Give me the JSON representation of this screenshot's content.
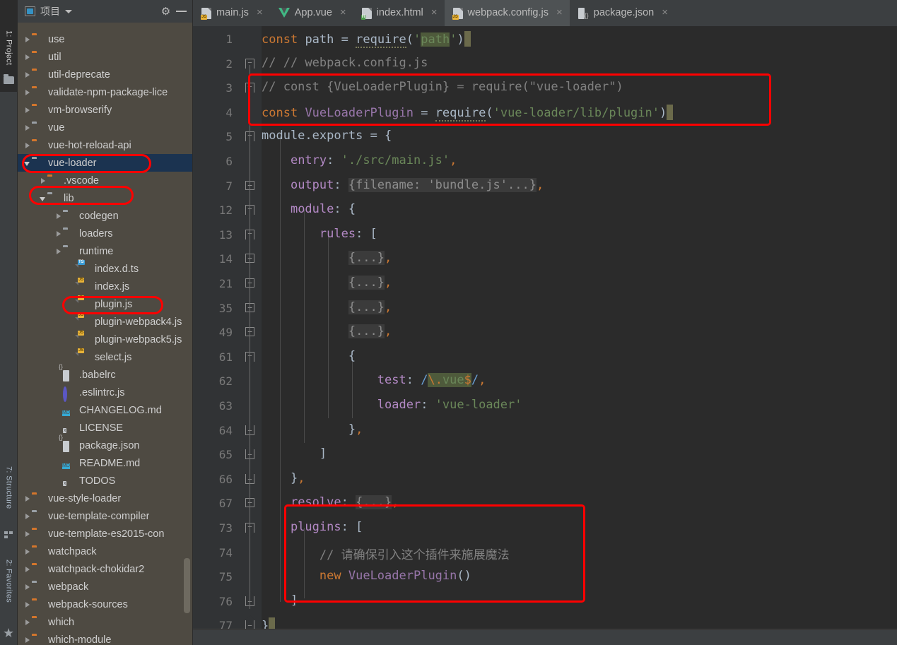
{
  "toolstrip": {
    "project": "1: Project",
    "structure": "7: Structure",
    "favorites": "2: Favorites",
    "project_icon": "folder-icon",
    "structure_icon": "grid-icon",
    "favorites_icon": "star-icon"
  },
  "panel": {
    "title": "项目",
    "dropdown_icon": "chevron-down-icon",
    "settings_icon": "gear-icon",
    "hide_icon": "minus-icon",
    "window_icon": "project-window-icon"
  },
  "tree": [
    {
      "label": "use",
      "indent": 0,
      "arrow": "closed",
      "icon": "folder-orange",
      "selected": false
    },
    {
      "label": "util",
      "indent": 0,
      "arrow": "closed",
      "icon": "folder-orange",
      "selected": false
    },
    {
      "label": "util-deprecate",
      "indent": 0,
      "arrow": "closed",
      "icon": "folder-orange",
      "selected": false
    },
    {
      "label": "validate-npm-package-lice",
      "indent": 0,
      "arrow": "closed",
      "icon": "folder-orange",
      "selected": false
    },
    {
      "label": "vm-browserify",
      "indent": 0,
      "arrow": "closed",
      "icon": "folder-orange",
      "selected": false
    },
    {
      "label": "vue",
      "indent": 0,
      "arrow": "closed",
      "icon": "folder-grey",
      "selected": false
    },
    {
      "label": "vue-hot-reload-api",
      "indent": 0,
      "arrow": "closed",
      "icon": "folder-orange",
      "selected": false
    },
    {
      "label": "vue-loader",
      "indent": 0,
      "arrow": "open",
      "icon": "folder-grey",
      "selected": true
    },
    {
      "label": ".vscode",
      "indent": 1,
      "arrow": "closed",
      "icon": "folder-orange",
      "selected": false
    },
    {
      "label": "lib",
      "indent": 1,
      "arrow": "open",
      "icon": "folder-grey",
      "selected": false
    },
    {
      "label": "codegen",
      "indent": 2,
      "arrow": "closed",
      "icon": "folder-grey",
      "selected": false
    },
    {
      "label": "loaders",
      "indent": 2,
      "arrow": "closed",
      "icon": "folder-grey",
      "selected": false
    },
    {
      "label": "runtime",
      "indent": 2,
      "arrow": "closed",
      "icon": "folder-grey",
      "selected": false
    },
    {
      "label": "index.d.ts",
      "indent": 3,
      "arrow": "none",
      "icon": "file-ts",
      "selected": false
    },
    {
      "label": "index.js",
      "indent": 3,
      "arrow": "none",
      "icon": "file-js",
      "selected": false
    },
    {
      "label": "plugin.js",
      "indent": 3,
      "arrow": "none",
      "icon": "file-js",
      "selected": false
    },
    {
      "label": "plugin-webpack4.js",
      "indent": 3,
      "arrow": "none",
      "icon": "file-js",
      "selected": false
    },
    {
      "label": "plugin-webpack5.js",
      "indent": 3,
      "arrow": "none",
      "icon": "file-js",
      "selected": false
    },
    {
      "label": "select.js",
      "indent": 3,
      "arrow": "none",
      "icon": "file-js",
      "selected": false
    },
    {
      "label": ".babelrc",
      "indent": 2,
      "arrow": "none",
      "icon": "file-json",
      "selected": false
    },
    {
      "label": ".eslintrc.js",
      "indent": 2,
      "arrow": "none",
      "icon": "file-eslint",
      "selected": false
    },
    {
      "label": "CHANGELOG.md",
      "indent": 2,
      "arrow": "none",
      "icon": "file-md",
      "selected": false
    },
    {
      "label": "LICENSE",
      "indent": 2,
      "arrow": "none",
      "icon": "file-text",
      "selected": false
    },
    {
      "label": "package.json",
      "indent": 2,
      "arrow": "none",
      "icon": "file-json",
      "selected": false
    },
    {
      "label": "README.md",
      "indent": 2,
      "arrow": "none",
      "icon": "file-md",
      "selected": false
    },
    {
      "label": "TODOS",
      "indent": 2,
      "arrow": "none",
      "icon": "file-text",
      "selected": false
    },
    {
      "label": "vue-style-loader",
      "indent": 0,
      "arrow": "closed",
      "icon": "folder-orange",
      "selected": false
    },
    {
      "label": "vue-template-compiler",
      "indent": 0,
      "arrow": "closed",
      "icon": "folder-grey",
      "selected": false
    },
    {
      "label": "vue-template-es2015-con",
      "indent": 0,
      "arrow": "closed",
      "icon": "folder-orange",
      "selected": false
    },
    {
      "label": "watchpack",
      "indent": 0,
      "arrow": "closed",
      "icon": "folder-orange",
      "selected": false
    },
    {
      "label": "watchpack-chokidar2",
      "indent": 0,
      "arrow": "closed",
      "icon": "folder-orange",
      "selected": false
    },
    {
      "label": "webpack",
      "indent": 0,
      "arrow": "closed",
      "icon": "folder-grey",
      "selected": false
    },
    {
      "label": "webpack-sources",
      "indent": 0,
      "arrow": "closed",
      "icon": "folder-orange",
      "selected": false
    },
    {
      "label": "which",
      "indent": 0,
      "arrow": "closed",
      "icon": "folder-orange",
      "selected": false
    },
    {
      "label": "which-module",
      "indent": 0,
      "arrow": "closed",
      "icon": "folder-orange",
      "selected": false
    }
  ],
  "tabs": [
    {
      "label": "main.js",
      "icon": "file-js",
      "active": false,
      "close": "×"
    },
    {
      "label": "App.vue",
      "icon": "file-vue",
      "active": false,
      "close": "×"
    },
    {
      "label": "index.html",
      "icon": "file-html",
      "active": false,
      "close": "×"
    },
    {
      "label": "webpack.config.js",
      "icon": "file-js",
      "active": true,
      "close": "×"
    },
    {
      "label": "package.json",
      "icon": "file-json",
      "active": false,
      "close": "×"
    }
  ],
  "code": {
    "line_numbers": [
      "1",
      "2",
      "3",
      "4",
      "5",
      "6",
      "7",
      "12",
      "13",
      "14",
      "21",
      "35",
      "49",
      "61",
      "62",
      "63",
      "64",
      "65",
      "66",
      "67",
      "73",
      "74",
      "75",
      "76",
      "77"
    ],
    "lines": [
      "const path = require('path')",
      "// // webpack.config.js",
      "// const {VueLoaderPlugin} = require(\"vue-loader\")",
      "const VueLoaderPlugin = require('vue-loader/lib/plugin')",
      "module.exports = {",
      "    entry: './src/main.js',",
      "    output: {filename: 'bundle.js'...},",
      "    module: {",
      "        rules: [",
      "            {...},",
      "            {...},",
      "            {...},",
      "            {...},",
      "            {",
      "                test: /\\.vue$/,",
      "                loader: 'vue-loader'",
      "            },",
      "        ]",
      "    },",
      "    resolve: {...},",
      "    plugins: [",
      "        // 请确保引入这个插件来施展魔法",
      "        new VueLoaderPlugin()",
      "    ]",
      "}"
    ]
  },
  "annotations": {
    "color": "#ff0000",
    "boxes": [
      {
        "name": "require-plugin-highlight",
        "target": "lines 3-4"
      },
      {
        "name": "vue-loader-folder-highlight",
        "target": "vue-loader tree row"
      },
      {
        "name": "lib-folder-highlight",
        "target": "lib tree row"
      },
      {
        "name": "plugin-js-highlight",
        "target": "plugin.js tree row"
      },
      {
        "name": "plugins-block-highlight",
        "target": "lines 73-76"
      }
    ]
  },
  "theme": {
    "editor_bg": "#2b2b2b",
    "gutter_bg": "#313335",
    "panel_bg": "#4e4a42",
    "chrome_bg": "#3c3f41",
    "selection_bg": "#1b3350",
    "keyword": "#cc7832",
    "string": "#6a8759",
    "property": "#b389c5",
    "comment": "#808080",
    "default_text": "#a9b7c6"
  }
}
